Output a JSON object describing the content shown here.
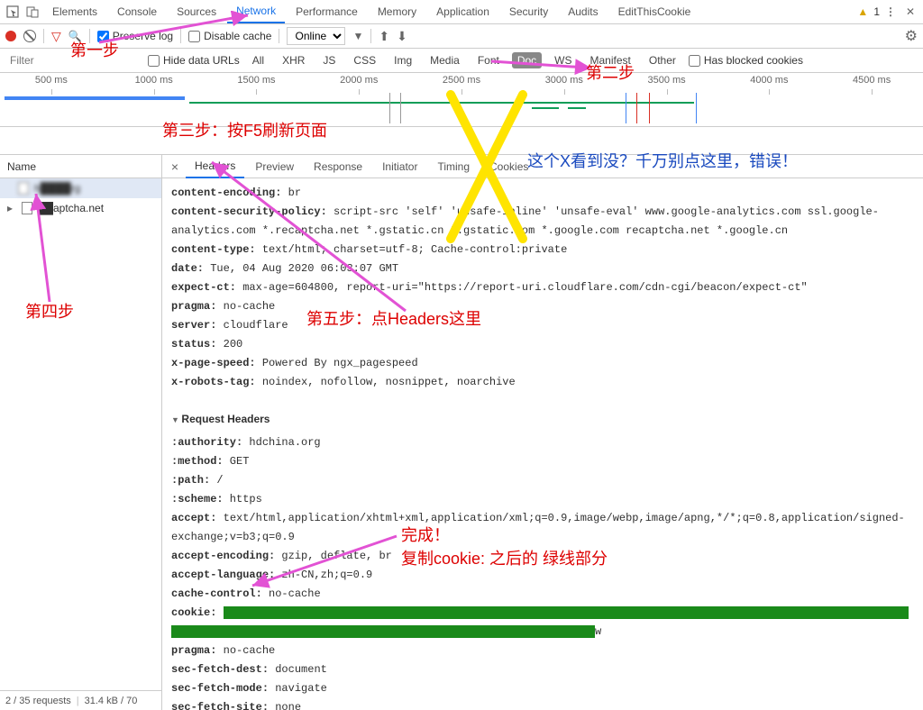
{
  "top_tabs": [
    "Elements",
    "Console",
    "Sources",
    "Network",
    "Performance",
    "Memory",
    "Application",
    "Security",
    "Audits",
    "EditThisCookie"
  ],
  "top_active_index": 3,
  "warn_count": "1",
  "toolbar": {
    "preserve_log_label": "Preserve log",
    "disable_cache_label": "Disable cache",
    "throttle": "Online"
  },
  "filter": {
    "placeholder": "Filter",
    "hide_urls_label": "Hide data URLs",
    "types": [
      "All",
      "XHR",
      "JS",
      "CSS",
      "Img",
      "Media",
      "Font",
      "Doc",
      "WS",
      "Manifest",
      "Other"
    ],
    "active_index": 7,
    "blocked_label": "Has blocked cookies"
  },
  "timeline_ticks": [
    "500 ms",
    "1000 ms",
    "1500 ms",
    "2000 ms",
    "2500 ms",
    "3000 ms",
    "3500 ms",
    "4000 ms",
    "4500 ms"
  ],
  "sidebar": {
    "head": "Name",
    "items": [
      "h████rg",
      "██aptcha.net"
    ],
    "footer_left": "2 / 35 requests",
    "footer_right": "31.4 kB / 70"
  },
  "detail_tabs": [
    "Headers",
    "Preview",
    "Response",
    "Initiator",
    "Timing",
    "Cookies"
  ],
  "detail_active_index": 0,
  "response_headers": [
    {
      "k": "content-encoding:",
      "v": " br"
    },
    {
      "k": "content-security-policy:",
      "v": " script-src 'self' 'unsafe-inline' 'unsafe-eval' www.google-analytics.com ssl.google-analytics.com *.recaptcha.net *.gstatic.cn *.gstatic.com *.google.com recaptcha.net *.google.cn"
    },
    {
      "k": "content-type:",
      "v": " text/html; charset=utf-8; Cache-control:private"
    },
    {
      "k": "date:",
      "v": " Tue, 04 Aug 2020 06:03:07 GMT"
    },
    {
      "k": "expect-ct:",
      "v": " max-age=604800, report-uri=\"https://report-uri.cloudflare.com/cdn-cgi/beacon/expect-ct\""
    },
    {
      "k": "pragma:",
      "v": " no-cache"
    },
    {
      "k": "server:",
      "v": " cloudflare"
    },
    {
      "k": "status:",
      "v": " 200"
    },
    {
      "k": "x-page-speed:",
      "v": " Powered By ngx_pagespeed"
    },
    {
      "k": "x-robots-tag:",
      "v": " noindex, nofollow, nosnippet, noarchive"
    }
  ],
  "request_section_title": "Request Headers",
  "request_headers": [
    {
      "k": ":authority:",
      "v": " hdchina.org"
    },
    {
      "k": ":method:",
      "v": " GET"
    },
    {
      "k": ":path:",
      "v": " /"
    },
    {
      "k": ":scheme:",
      "v": " https"
    },
    {
      "k": "accept:",
      "v": " text/html,application/xhtml+xml,application/xml;q=0.9,image/webp,image/apng,*/*;q=0.8,application/signed-exchange;v=b3;q=0.9"
    },
    {
      "k": "accept-encoding:",
      "v": " gzip, deflate, br"
    },
    {
      "k": "accept-language:",
      "v": " zh-CN,zh;q=0.9"
    },
    {
      "k": "cache-control:",
      "v": " no-cache"
    }
  ],
  "request_headers_after_cookie": [
    {
      "k": "pragma:",
      "v": " no-cache"
    },
    {
      "k": "sec-fetch-dest:",
      "v": " document"
    },
    {
      "k": "sec-fetch-mode:",
      "v": " navigate"
    },
    {
      "k": "sec-fetch-site:",
      "v": " none"
    }
  ],
  "cookie_label": "cookie:",
  "annotations": {
    "step1": "第一步",
    "step2": "第二步",
    "step3": "第三步：按F5刷新页面",
    "step4": "第四步",
    "step5": "第五步：点Headers这里",
    "x_note": "这个X看到没？千万别点这里，错误！",
    "done1": "完成！",
    "done2": "复制cookie: 之后的 绿线部分"
  }
}
